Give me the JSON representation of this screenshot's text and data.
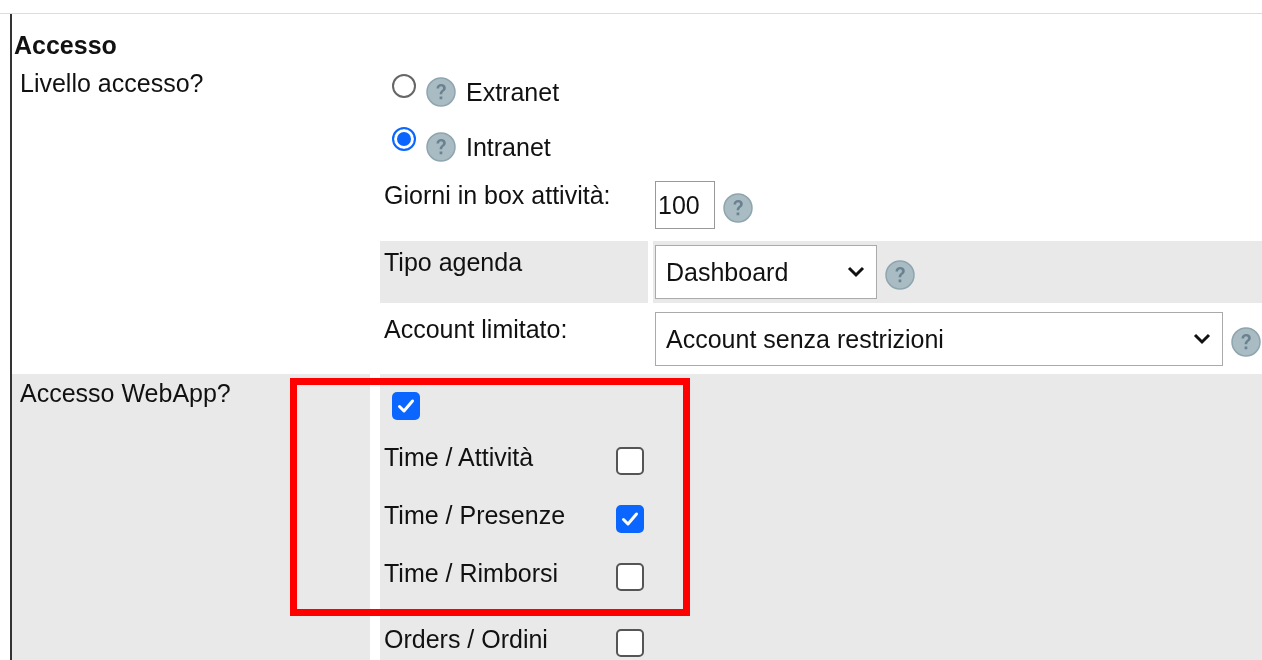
{
  "section_title": "Accesso",
  "access_level": {
    "label": "Livello accesso?",
    "options": [
      {
        "label": "Extranet",
        "selected": false
      },
      {
        "label": "Intranet",
        "selected": true
      }
    ]
  },
  "settings": [
    {
      "kind": "number",
      "label": "Giorni in box attività:",
      "value": "100"
    },
    {
      "kind": "select",
      "label": "Tipo agenda",
      "value": "Dashboard"
    },
    {
      "kind": "wide_select",
      "label": "Account limitato:",
      "value": "Account senza restrizioni"
    }
  ],
  "webapp": {
    "label": "Accesso WebApp?",
    "checked": true,
    "modules": [
      {
        "label": "Time / Attività",
        "checked": false
      },
      {
        "label": "Time / Presenze",
        "checked": true
      },
      {
        "label": "Time / Rimborsi",
        "checked": false
      },
      {
        "label": "Orders / Ordini",
        "checked": false
      }
    ]
  }
}
